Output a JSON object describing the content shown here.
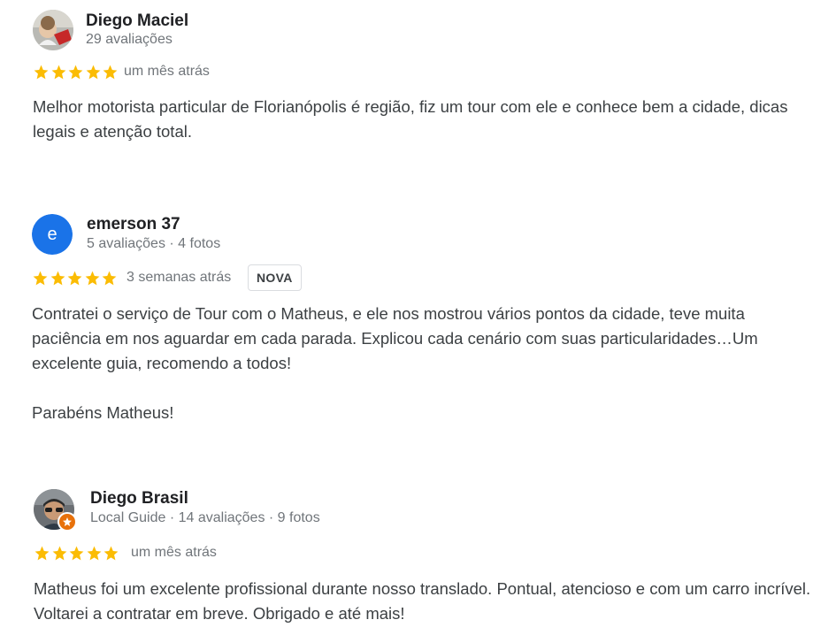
{
  "colors": {
    "star": "#fbbc04",
    "letter_avatar_bg": "#1a73e8",
    "guide_badge": "#e8710a"
  },
  "reviews": [
    {
      "name": "Diego Maciel",
      "meta": "29 avaliações",
      "rating": 5,
      "when": "um mês atrás",
      "text": "Melhor motorista particular de Florianópolis é região, fiz um tour com ele e conhece bem a cidade, dicas legais e atenção total.",
      "avatar_icon": "photo-avatar"
    },
    {
      "name": "emerson 37",
      "meta": "5 avaliações · 4 fotos",
      "rating": 5,
      "when": "3 semanas atrás",
      "badge": "NOVA",
      "avatar_letter": "e",
      "text_p1": "Contratei o serviço de Tour com o Matheus, e ele nos mostrou vários pontos da cidade, teve muita paciência em nos aguardar em cada parada. Explicou cada cenário com suas particularidades…Um excelente guia, recomendo a todos!",
      "text_p2": "Parabéns Matheus!"
    },
    {
      "name": "Diego Brasil",
      "meta": "Local Guide · 14 avaliações · 9 fotos",
      "rating": 5,
      "when": "um mês atrás",
      "text": "Matheus foi um excelente profissional durante nosso translado. Pontual, atencioso e com um carro incrível. Voltarei a contratar em breve. Obrigado e até mais!",
      "avatar_icon": "photo-avatar",
      "badge_icon": "local-guide-star-icon"
    }
  ]
}
